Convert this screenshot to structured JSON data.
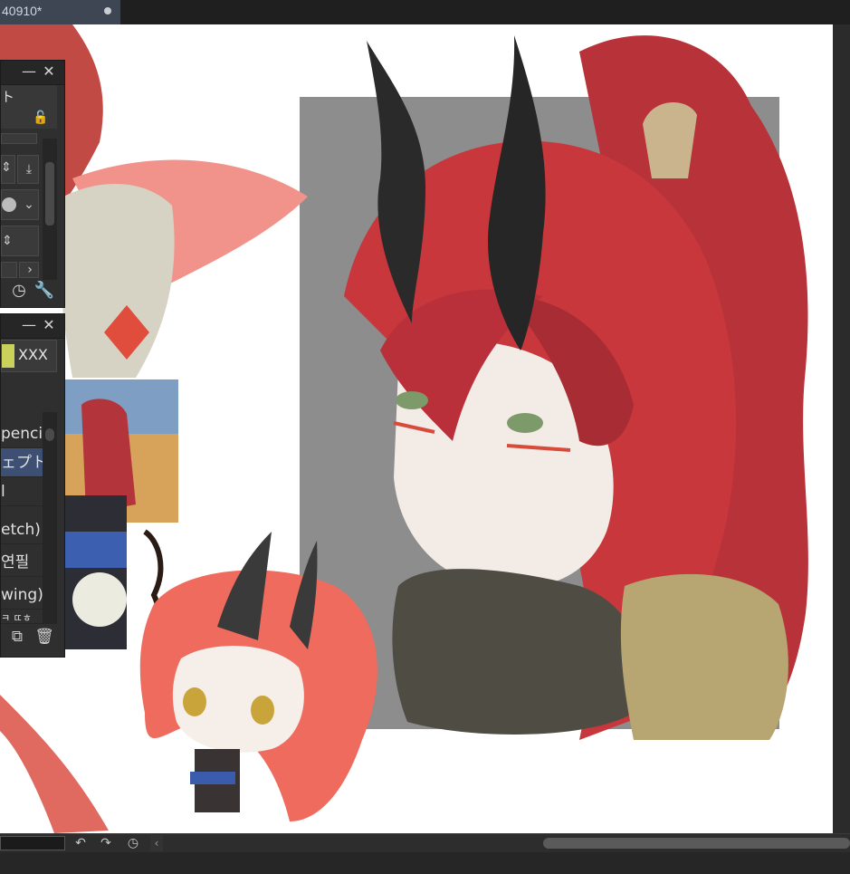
{
  "document_tab": {
    "title": "40910*"
  },
  "tool_property_palette": {
    "minimize_label": "—",
    "close_label": "✕",
    "label_fragment": "ト"
  },
  "sub_tool_palette": {
    "minimize_label": "—",
    "close_label": "✕",
    "group_name": "XXX",
    "items": [
      {
        "label": "pencil",
        "selected": false
      },
      {
        "label": "ェプト",
        "selected": true
      },
      {
        "label": "l",
        "selected": false
      },
      {
        "label": "etch)",
        "selected": false
      },
      {
        "label": "연필",
        "selected": false
      },
      {
        "label": "wing)",
        "selected": false
      },
      {
        "label": "ㅋ ㄸㅎ",
        "selected": false
      }
    ]
  },
  "icons": {
    "lock": "lock-icon",
    "download": "download-icon",
    "stepper": "chevron-updown-icon",
    "dropdown": "chevron-down-icon",
    "chevron_right": "chevron-right-icon",
    "brush_size": "dial-icon",
    "settings": "wrench-icon",
    "add_subtool": "copy-plus-icon",
    "delete": "trash-icon",
    "undo": "undo-icon",
    "redo": "redo-icon",
    "rotate": "dial-icon"
  },
  "colors": {
    "canvas_bg": "#ffffff",
    "ui_bg": "#2f2f2f",
    "selection": "#3d4f72",
    "hair_red": "#c8353a",
    "hair_light": "#f08a84",
    "horn": "#2a2a2a",
    "gray_block": "#8c8c8c"
  }
}
